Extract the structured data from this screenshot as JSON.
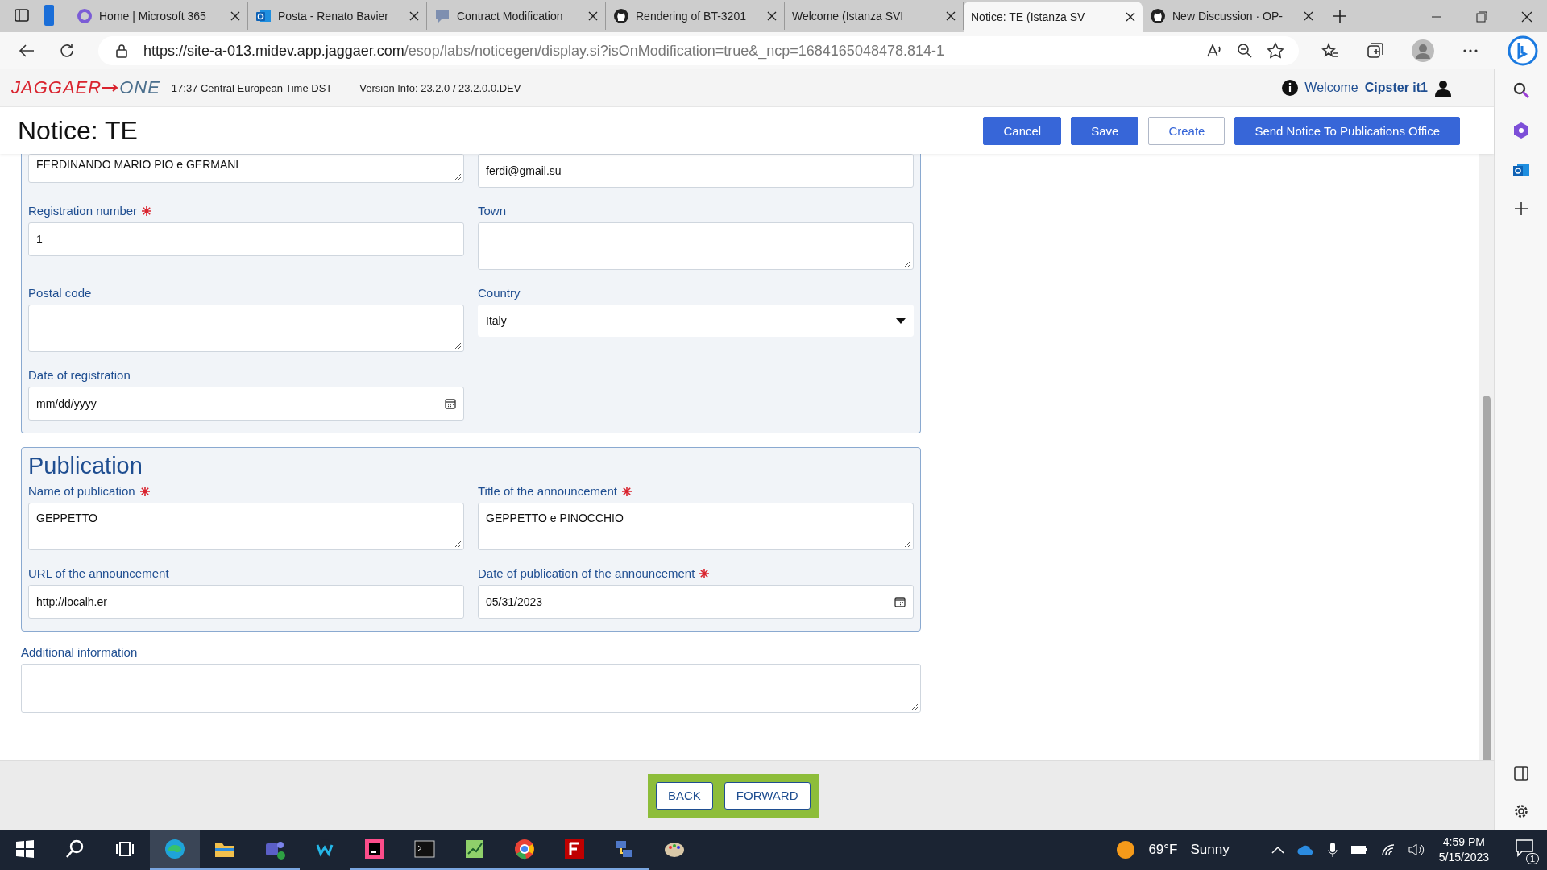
{
  "browser": {
    "tabs": [
      {
        "title": "Home | Microsoft 365",
        "kind": "m365",
        "selected": false
      },
      {
        "title": "Posta - Renato Bavier",
        "kind": "outlook",
        "selected": false
      },
      {
        "title": "Contract Modification",
        "kind": "chat",
        "selected": false
      },
      {
        "title": "Rendering of BT-3201",
        "kind": "github",
        "selected": false
      },
      {
        "title": "Welcome (Istanza SVI",
        "kind": "blank",
        "selected": false
      },
      {
        "title": "Notice: TE (Istanza SV",
        "kind": "blank",
        "selected": true
      },
      {
        "title": "New Discussion · OP-",
        "kind": "github",
        "selected": false
      }
    ],
    "url_host": "https://site-a-013.midev.app.jaggaer.com",
    "url_path": "/esop/labs/noticegen/display.si?isOnModification=true&_ncp=1684165048478.814-1"
  },
  "app": {
    "logo_main": "JAGGAER",
    "logo_suffix": "ONE",
    "time": "17:37 Central European Time DST",
    "version": "Version Info: 23.2.0 / 23.2.0.0.DEV",
    "welcome": "Welcome",
    "user": "Cipster it1"
  },
  "page": {
    "title": "Notice: TE",
    "actions": [
      {
        "label": "Cancel",
        "kind": "primary"
      },
      {
        "label": "Save",
        "kind": "primary"
      },
      {
        "label": "Create",
        "kind": "outline"
      },
      {
        "label": "Send Notice To Publications Office",
        "kind": "primary"
      }
    ]
  },
  "sections": [
    {
      "fields": [
        {
          "kind": "textarea",
          "value": "FERDINANDO MARIO PIO e GERMANI",
          "required": false
        },
        {
          "kind": "text",
          "value": "ferdi@gmail.su",
          "required": false
        },
        {
          "label": "Registration number",
          "kind": "text",
          "value": "1",
          "required": true
        },
        {
          "label": "Town",
          "kind": "textarea",
          "required": false
        },
        {
          "label": "Postal code",
          "kind": "textarea",
          "required": false
        },
        {
          "label": "Country",
          "kind": "select",
          "value": "Italy",
          "required": false
        },
        {
          "label": "Date of registration",
          "kind": "date",
          "placeholder": "mm/dd/yyyy",
          "required": false
        }
      ]
    },
    {
      "title": "Publication",
      "fields": [
        {
          "label": "Name of publication",
          "kind": "textarea",
          "value": "GEPPETTO",
          "required": true
        },
        {
          "label": "Title of the announcement",
          "kind": "textarea",
          "value": "GEPPETTO e PINOCCHIO",
          "required": true
        },
        {
          "label": "URL of the announcement",
          "kind": "text",
          "value": "http://localh.er",
          "required": false
        },
        {
          "label": "Date of publication of the announcement",
          "kind": "date",
          "value": "05/31/2023",
          "required": true
        }
      ]
    }
  ],
  "additional": {
    "label": "Additional information"
  },
  "footer": {
    "buttons": [
      "BACK",
      "FORWARD"
    ]
  },
  "taskbar": {
    "temperature": "69°F",
    "weather": "Sunny",
    "time": "4:59 PM",
    "date": "5/15/2023",
    "notifications": "1"
  }
}
